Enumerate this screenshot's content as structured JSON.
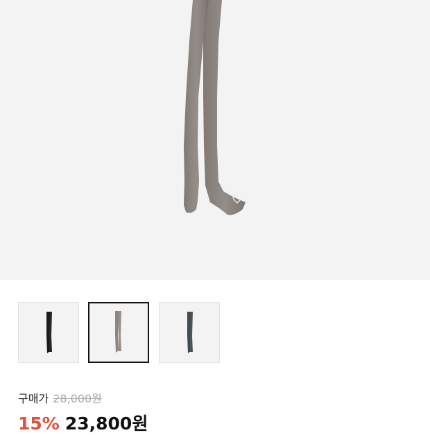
{
  "product": {
    "main_image": "gray-satin-scarf-image",
    "color_options": [
      {
        "name": "black",
        "color": "#1b1b1b",
        "selected": false
      },
      {
        "name": "gray",
        "color": "#8d857f",
        "selected": true
      },
      {
        "name": "charcoal",
        "color": "#414a4f",
        "selected": false
      }
    ]
  },
  "price": {
    "label": "구매가",
    "original": "28,000원",
    "discount": "15%",
    "final": "23,800원"
  },
  "colors": {
    "discount": "#e0503c",
    "hero_bg": "#f3f3f3",
    "scarf_gray": "#8d857f"
  }
}
